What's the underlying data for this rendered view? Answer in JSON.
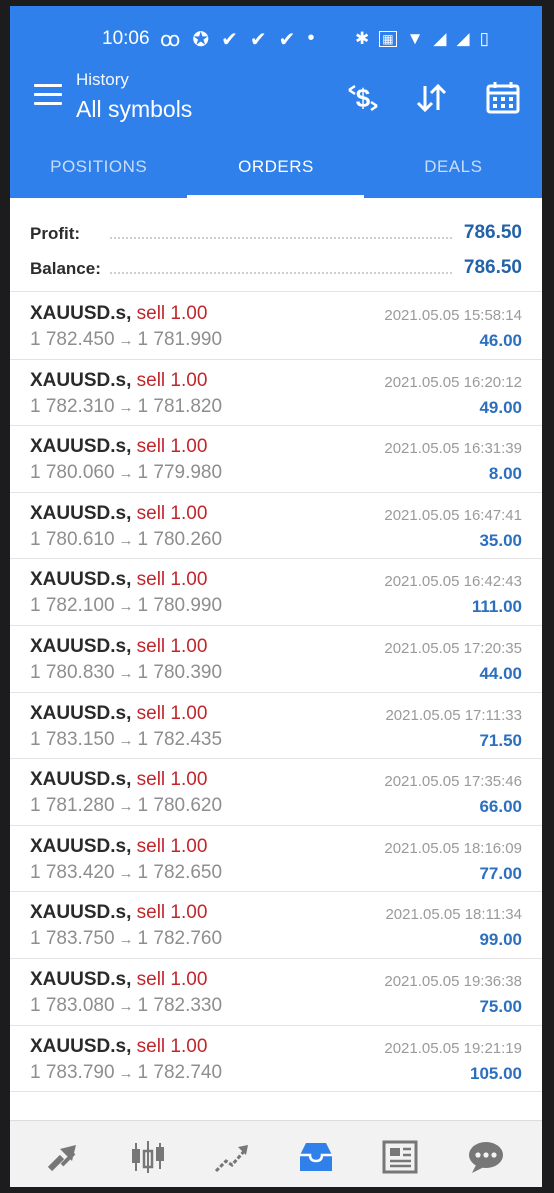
{
  "status_bar": {
    "time": "10:06",
    "left_icons": [
      "voicemail-icon",
      "notification-icon",
      "check-icon",
      "check-icon",
      "check-icon",
      "dot-icon"
    ],
    "right_icons": [
      "bluetooth-icon",
      "volte-icon",
      "wifi-icon",
      "signal-icon",
      "signal-icon",
      "battery-icon"
    ]
  },
  "header": {
    "subtitle": "History",
    "title": "All symbols",
    "actions": [
      "currency-sort-icon",
      "sort-arrows-icon",
      "calendar-icon"
    ],
    "color": "#2f80ea"
  },
  "tabs": [
    {
      "label": "POSITIONS",
      "active": false
    },
    {
      "label": "ORDERS",
      "active": true
    },
    {
      "label": "DEALS",
      "active": false
    }
  ],
  "summary": {
    "profit_label": "Profit:",
    "profit_value": "786.50",
    "balance_label": "Balance:",
    "balance_value": "786.50"
  },
  "orders": [
    {
      "symbol": "XAUUSD.s,",
      "side": "sell 1.00",
      "open": "1 782.450",
      "close": "1 781.990",
      "time": "2021.05.05 15:58:14",
      "profit": "46.00"
    },
    {
      "symbol": "XAUUSD.s,",
      "side": "sell 1.00",
      "open": "1 782.310",
      "close": "1 781.820",
      "time": "2021.05.05 16:20:12",
      "profit": "49.00"
    },
    {
      "symbol": "XAUUSD.s,",
      "side": "sell 1.00",
      "open": "1 780.060",
      "close": "1 779.980",
      "time": "2021.05.05 16:31:39",
      "profit": "8.00"
    },
    {
      "symbol": "XAUUSD.s,",
      "side": "sell 1.00",
      "open": "1 780.610",
      "close": "1 780.260",
      "time": "2021.05.05 16:47:41",
      "profit": "35.00"
    },
    {
      "symbol": "XAUUSD.s,",
      "side": "sell 1.00",
      "open": "1 782.100",
      "close": "1 780.990",
      "time": "2021.05.05 16:42:43",
      "profit": "111.00"
    },
    {
      "symbol": "XAUUSD.s,",
      "side": "sell 1.00",
      "open": "1 780.830",
      "close": "1 780.390",
      "time": "2021.05.05 17:20:35",
      "profit": "44.00"
    },
    {
      "symbol": "XAUUSD.s,",
      "side": "sell 1.00",
      "open": "1 783.150",
      "close": "1 782.435",
      "time": "2021.05.05 17:11:33",
      "profit": "71.50"
    },
    {
      "symbol": "XAUUSD.s,",
      "side": "sell 1.00",
      "open": "1 781.280",
      "close": "1 780.620",
      "time": "2021.05.05 17:35:46",
      "profit": "66.00"
    },
    {
      "symbol": "XAUUSD.s,",
      "side": "sell 1.00",
      "open": "1 783.420",
      "close": "1 782.650",
      "time": "2021.05.05 18:16:09",
      "profit": "77.00"
    },
    {
      "symbol": "XAUUSD.s,",
      "side": "sell 1.00",
      "open": "1 783.750",
      "close": "1 782.760",
      "time": "2021.05.05 18:11:34",
      "profit": "99.00"
    },
    {
      "symbol": "XAUUSD.s,",
      "side": "sell 1.00",
      "open": "1 783.080",
      "close": "1 782.330",
      "time": "2021.05.05 19:36:38",
      "profit": "75.00"
    },
    {
      "symbol": "XAUUSD.s,",
      "side": "sell 1.00",
      "open": "1 783.790",
      "close": "1 782.740",
      "time": "2021.05.05 19:21:19",
      "profit": "105.00"
    }
  ],
  "bottom_nav": [
    {
      "icon": "quotes-icon",
      "active": false
    },
    {
      "icon": "chart-icon",
      "active": false
    },
    {
      "icon": "trade-icon",
      "active": false
    },
    {
      "icon": "history-icon",
      "active": true
    },
    {
      "icon": "news-icon",
      "active": false
    },
    {
      "icon": "chat-icon",
      "active": false
    }
  ],
  "colors": {
    "accent": "#2f80ea",
    "sell": "#c0262c",
    "profit": "#2c6fbf"
  }
}
